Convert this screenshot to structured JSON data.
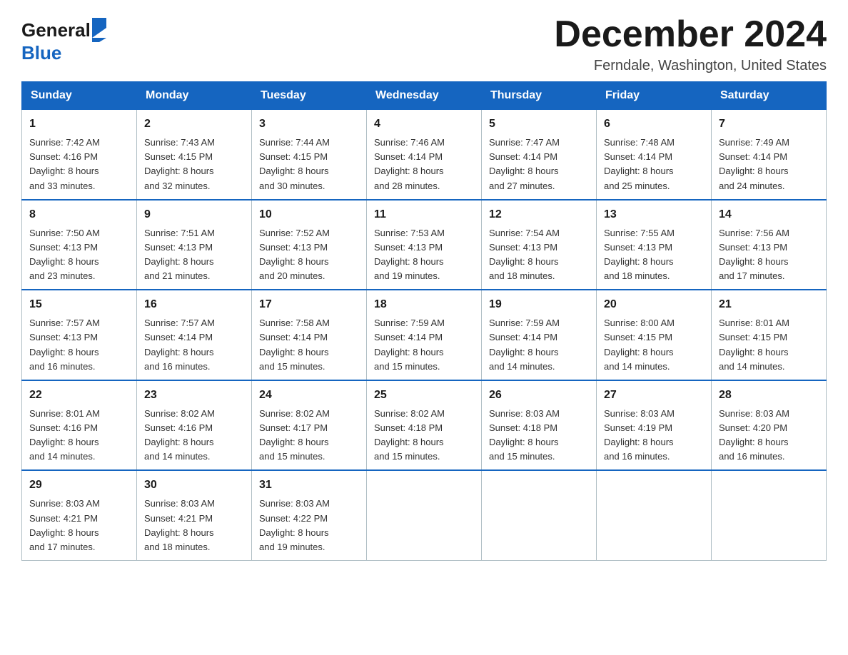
{
  "header": {
    "logo_general": "General",
    "logo_blue": "Blue",
    "month_title": "December 2024",
    "location": "Ferndale, Washington, United States"
  },
  "days_of_week": [
    "Sunday",
    "Monday",
    "Tuesday",
    "Wednesday",
    "Thursday",
    "Friday",
    "Saturday"
  ],
  "weeks": [
    [
      {
        "day": "1",
        "sunrise": "7:42 AM",
        "sunset": "4:16 PM",
        "daylight": "8 hours and 33 minutes."
      },
      {
        "day": "2",
        "sunrise": "7:43 AM",
        "sunset": "4:15 PM",
        "daylight": "8 hours and 32 minutes."
      },
      {
        "day": "3",
        "sunrise": "7:44 AM",
        "sunset": "4:15 PM",
        "daylight": "8 hours and 30 minutes."
      },
      {
        "day": "4",
        "sunrise": "7:46 AM",
        "sunset": "4:14 PM",
        "daylight": "8 hours and 28 minutes."
      },
      {
        "day": "5",
        "sunrise": "7:47 AM",
        "sunset": "4:14 PM",
        "daylight": "8 hours and 27 minutes."
      },
      {
        "day": "6",
        "sunrise": "7:48 AM",
        "sunset": "4:14 PM",
        "daylight": "8 hours and 25 minutes."
      },
      {
        "day": "7",
        "sunrise": "7:49 AM",
        "sunset": "4:14 PM",
        "daylight": "8 hours and 24 minutes."
      }
    ],
    [
      {
        "day": "8",
        "sunrise": "7:50 AM",
        "sunset": "4:13 PM",
        "daylight": "8 hours and 23 minutes."
      },
      {
        "day": "9",
        "sunrise": "7:51 AM",
        "sunset": "4:13 PM",
        "daylight": "8 hours and 21 minutes."
      },
      {
        "day": "10",
        "sunrise": "7:52 AM",
        "sunset": "4:13 PM",
        "daylight": "8 hours and 20 minutes."
      },
      {
        "day": "11",
        "sunrise": "7:53 AM",
        "sunset": "4:13 PM",
        "daylight": "8 hours and 19 minutes."
      },
      {
        "day": "12",
        "sunrise": "7:54 AM",
        "sunset": "4:13 PM",
        "daylight": "8 hours and 18 minutes."
      },
      {
        "day": "13",
        "sunrise": "7:55 AM",
        "sunset": "4:13 PM",
        "daylight": "8 hours and 18 minutes."
      },
      {
        "day": "14",
        "sunrise": "7:56 AM",
        "sunset": "4:13 PM",
        "daylight": "8 hours and 17 minutes."
      }
    ],
    [
      {
        "day": "15",
        "sunrise": "7:57 AM",
        "sunset": "4:13 PM",
        "daylight": "8 hours and 16 minutes."
      },
      {
        "day": "16",
        "sunrise": "7:57 AM",
        "sunset": "4:14 PM",
        "daylight": "8 hours and 16 minutes."
      },
      {
        "day": "17",
        "sunrise": "7:58 AM",
        "sunset": "4:14 PM",
        "daylight": "8 hours and 15 minutes."
      },
      {
        "day": "18",
        "sunrise": "7:59 AM",
        "sunset": "4:14 PM",
        "daylight": "8 hours and 15 minutes."
      },
      {
        "day": "19",
        "sunrise": "7:59 AM",
        "sunset": "4:14 PM",
        "daylight": "8 hours and 14 minutes."
      },
      {
        "day": "20",
        "sunrise": "8:00 AM",
        "sunset": "4:15 PM",
        "daylight": "8 hours and 14 minutes."
      },
      {
        "day": "21",
        "sunrise": "8:01 AM",
        "sunset": "4:15 PM",
        "daylight": "8 hours and 14 minutes."
      }
    ],
    [
      {
        "day": "22",
        "sunrise": "8:01 AM",
        "sunset": "4:16 PM",
        "daylight": "8 hours and 14 minutes."
      },
      {
        "day": "23",
        "sunrise": "8:02 AM",
        "sunset": "4:16 PM",
        "daylight": "8 hours and 14 minutes."
      },
      {
        "day": "24",
        "sunrise": "8:02 AM",
        "sunset": "4:17 PM",
        "daylight": "8 hours and 15 minutes."
      },
      {
        "day": "25",
        "sunrise": "8:02 AM",
        "sunset": "4:18 PM",
        "daylight": "8 hours and 15 minutes."
      },
      {
        "day": "26",
        "sunrise": "8:03 AM",
        "sunset": "4:18 PM",
        "daylight": "8 hours and 15 minutes."
      },
      {
        "day": "27",
        "sunrise": "8:03 AM",
        "sunset": "4:19 PM",
        "daylight": "8 hours and 16 minutes."
      },
      {
        "day": "28",
        "sunrise": "8:03 AM",
        "sunset": "4:20 PM",
        "daylight": "8 hours and 16 minutes."
      }
    ],
    [
      {
        "day": "29",
        "sunrise": "8:03 AM",
        "sunset": "4:21 PM",
        "daylight": "8 hours and 17 minutes."
      },
      {
        "day": "30",
        "sunrise": "8:03 AM",
        "sunset": "4:21 PM",
        "daylight": "8 hours and 18 minutes."
      },
      {
        "day": "31",
        "sunrise": "8:03 AM",
        "sunset": "4:22 PM",
        "daylight": "8 hours and 19 minutes."
      },
      null,
      null,
      null,
      null
    ]
  ],
  "labels": {
    "sunrise": "Sunrise:",
    "sunset": "Sunset:",
    "daylight": "Daylight:"
  }
}
